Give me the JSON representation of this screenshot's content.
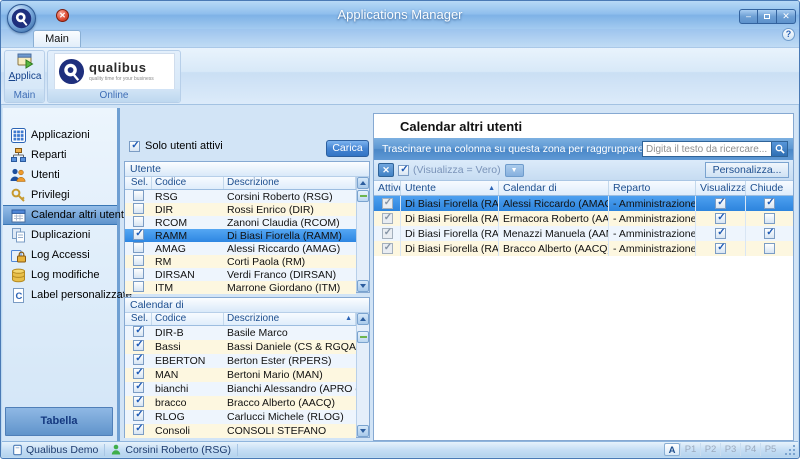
{
  "window": {
    "title": "Applications Manager"
  },
  "colors": {
    "accent": "#3f7fc0",
    "selection": "#3a8fe8",
    "row_alt": "#fdf7e0",
    "chrome": "#8abbe9"
  },
  "ribbon": {
    "tab": "Main",
    "applica_label": "Applica",
    "group_main_label": "Main",
    "group_online_label": "Online",
    "logo_brand": "qualibus",
    "logo_tagline": "quality time for your business"
  },
  "sidebar": {
    "items": [
      {
        "id": "applicazioni",
        "label": "Applicazioni",
        "icon": "applications-grid-icon",
        "selected": false
      },
      {
        "id": "reparti",
        "label": "Reparti",
        "icon": "departments-icon",
        "selected": false
      },
      {
        "id": "utenti",
        "label": "Utenti",
        "icon": "users-icon",
        "selected": false
      },
      {
        "id": "privilegi",
        "label": "Privilegi",
        "icon": "key-icon",
        "selected": false
      },
      {
        "id": "calendar-altri-utenti",
        "label": "Calendar altri utenti",
        "icon": "calendar-icon",
        "selected": true
      },
      {
        "id": "duplicazioni",
        "label": "Duplicazioni",
        "icon": "duplicate-icon",
        "selected": false
      },
      {
        "id": "log-accessi",
        "label": "Log Accessi",
        "icon": "access-log-icon",
        "selected": false
      },
      {
        "id": "log-modifiche",
        "label": "Log modifiche",
        "icon": "changes-log-icon",
        "selected": false
      },
      {
        "id": "label-personalizzate",
        "label": "Label personalizzate",
        "icon": "custom-labels-icon",
        "selected": false
      }
    ],
    "footer_label": "Tabella"
  },
  "left_panel": {
    "solo_utenti_attivi_label": "Solo utenti attivi",
    "solo_utenti_attivi_checked": true,
    "carica_label": "Carica",
    "utente_table": {
      "group_label": "Utente",
      "columns": [
        "Sel.",
        "Codice",
        "Descrizione"
      ],
      "rows": [
        {
          "sel": false,
          "codice": "RSG",
          "descrizione": "Corsini Roberto (RSG)",
          "selected": false
        },
        {
          "sel": false,
          "codice": "DIR",
          "descrizione": "Rossi Enrico (DIR)",
          "selected": false
        },
        {
          "sel": false,
          "codice": "RCOM",
          "descrizione": "Zanoni Claudia (RCOM)",
          "selected": false
        },
        {
          "sel": true,
          "codice": "RAMM",
          "descrizione": "Di Biasi Fiorella (RAMM)",
          "selected": true
        },
        {
          "sel": false,
          "codice": "AMAG",
          "descrizione": "Alessi Riccardo (AMAG)",
          "selected": false
        },
        {
          "sel": false,
          "codice": "RM",
          "descrizione": "Corti Paola (RM)",
          "selected": false
        },
        {
          "sel": false,
          "codice": "DIRSAN",
          "descrizione": "Verdi Franco (DIRSAN)",
          "selected": false
        },
        {
          "sel": false,
          "codice": "ITM",
          "descrizione": "Marrone Giordano (ITM)",
          "selected": false
        }
      ]
    },
    "calendar_di_table": {
      "group_label": "Calendar di",
      "columns": [
        "Sel.",
        "Codice",
        "Descrizione"
      ],
      "sort_column": "Descrizione",
      "sort_direction": "asc",
      "rows": [
        {
          "sel": true,
          "codice": "DIR-B",
          "descrizione": "Basile Marco"
        },
        {
          "sel": true,
          "codice": "Bassi",
          "descrizione": "Bassi Daniele (CS & RGQA)"
        },
        {
          "sel": true,
          "codice": "EBERTON",
          "descrizione": "Berton Ester (RPERS)"
        },
        {
          "sel": true,
          "codice": "MAN",
          "descrizione": "Bertoni Mario (MAN)"
        },
        {
          "sel": true,
          "codice": "bianchi",
          "descrizione": "Bianchi Alessandro (APRO e CM)"
        },
        {
          "sel": true,
          "codice": "bracco",
          "descrizione": "Bracco Alberto (AACQ)"
        },
        {
          "sel": true,
          "codice": "RLOG",
          "descrizione": "Carlucci Michele (RLOG)"
        },
        {
          "sel": true,
          "codice": "Consoli",
          "descrizione": "CONSOLI STEFANO"
        }
      ]
    }
  },
  "main_panel": {
    "title": "Calendar altri utenti",
    "group_by_hint": "Trascinare una colonna su questa zona per raggruppare",
    "search_placeholder": "Digita il testo da ricercare...",
    "filter_text": "(Visualizza = Vero)",
    "personalizza_label": "Personalizza...",
    "table": {
      "columns": [
        "Attivo",
        "Utente",
        "Calendar di",
        "Reparto",
        "Visualizza",
        "Chiude"
      ],
      "sort_column": "Utente",
      "filter_column": "Visualizza",
      "rows": [
        {
          "attivo": true,
          "utente": "Di Biasi Fiorella (RAMM)",
          "calendar_di": "Alessi Riccardo (AMAG)",
          "reparto": "- Amministrazione",
          "visualizza": true,
          "chiude": true,
          "selected": true
        },
        {
          "attivo": true,
          "utente": "Di Biasi Fiorella (RAMM)",
          "calendar_di": "Ermacora Roberto (AACQ)",
          "reparto": "- Amministrazione",
          "visualizza": true,
          "chiude": false,
          "selected": false
        },
        {
          "attivo": true,
          "utente": "Di Biasi Fiorella (RAMM)",
          "calendar_di": "Menazzi Manuela (AAMM)",
          "reparto": "- Amministrazione",
          "visualizza": true,
          "chiude": true,
          "selected": false
        },
        {
          "attivo": true,
          "utente": "Di Biasi Fiorella (RAMM)",
          "calendar_di": "Bracco Alberto (AACQ)",
          "reparto": "- Amministrazione",
          "visualizza": true,
          "chiude": false,
          "selected": false
        }
      ]
    }
  },
  "status_bar": {
    "database": "Qualibus Demo",
    "user": "Corsini Roberto (RSG)",
    "pages": [
      {
        "label": "A",
        "active": true
      },
      {
        "label": "P1",
        "active": false
      },
      {
        "label": "P2",
        "active": false
      },
      {
        "label": "P3",
        "active": false
      },
      {
        "label": "P4",
        "active": false
      },
      {
        "label": "P5",
        "active": false
      }
    ]
  }
}
